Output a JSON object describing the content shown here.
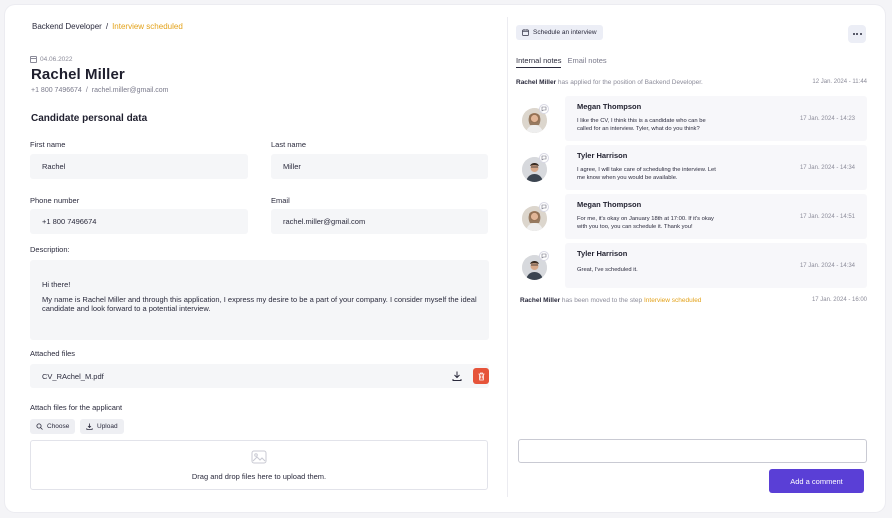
{
  "breadcrumb": {
    "position": "Backend Developer",
    "separator": "/",
    "status": "Interview scheduled"
  },
  "candidate": {
    "date": "04.06.2022",
    "name": "Rachel Miller",
    "phone": "+1 800 7496674",
    "contact_sep": "/",
    "email": "rachel.miller@gmail.com"
  },
  "form": {
    "section_title": "Candidate personal data",
    "first_name_label": "First name",
    "first_name": "Rachel",
    "last_name_label": "Last name",
    "last_name": "Miller",
    "phone_label": "Phone number",
    "phone": "+1 800 7496674",
    "email_label": "Email",
    "email": "rachel.miller@gmail.com",
    "description_label": "Description:",
    "description_greeting": "Hi there!",
    "description_body": "My name is Rachel Miller and through this application, I express my desire to be a part of your company. I consider myself the ideal candidate and look forward to a potential interview.",
    "attached_label": "Attached files",
    "attached_file": "CV_RAchel_M.pdf",
    "attach_for_label": "Attach files for the applicant",
    "choose_label": "Choose",
    "upload_label": "Upload",
    "dropzone_text": "Drag and drop files here to upload them."
  },
  "right": {
    "schedule_label": "Schedule an interview",
    "tabs": [
      {
        "label": "Internal notes",
        "active": true
      },
      {
        "label": "Email notes",
        "active": false
      }
    ],
    "applied_log": {
      "name": "Rachel Miller",
      "text": "has applied for the position of Backend Developer.",
      "time": "12 Jan. 2024 - 11:44"
    },
    "comments": [
      {
        "name": "Megan Thompson",
        "text": "I like the CV, I think this is a candidate who can be called for an interview. Tyler, what do you think?",
        "time": "17 Jan. 2024 - 14:23"
      },
      {
        "name": "Tyler Harrison",
        "text": "I agree, I will take care of scheduling the interview. Let me know when you would be available.",
        "time": "17 Jan. 2024 - 14:34"
      },
      {
        "name": "Megan Thompson",
        "text": "For me, it's okay on January 18th at 17:00. If it's okay with you too, you can schedule it. Thank you!",
        "time": "17 Jan. 2024 - 14:51"
      },
      {
        "name": "Tyler Harrison",
        "text": "Great, I've scheduled it.",
        "time": "17 Jan. 2024 - 14:34"
      }
    ],
    "moved_log": {
      "name": "Rachel Miller",
      "text": "has been moved to the step",
      "step": "Interview scheduled",
      "time": "17 Jan. 2024 - 16:00"
    },
    "add_comment_label": "Add a comment"
  },
  "colors": {
    "accent": "#e3a21a",
    "primary": "#5a3fd6",
    "danger": "#e6543a"
  }
}
